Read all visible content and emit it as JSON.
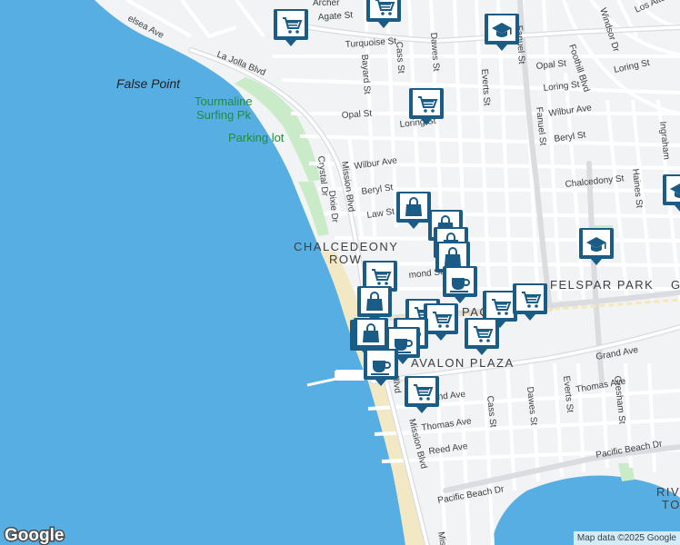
{
  "places": {
    "false_point": "False Point",
    "tourmaline_1": "Tourmaline",
    "tourmaline_2": "Surfing Pk",
    "parking": "Parking lot",
    "chalcedeony_1": "CHALCEDEONY",
    "chalcedeony_2": "ROW",
    "felspar_park": "FELSPAR PARK",
    "avalon_plaza": "AVALON PLAZA",
    "pac": "PAC",
    "riv": "RIV",
    "to": "TO",
    "g_edge": "G"
  },
  "streets": {
    "chelsea": "elsea Ave",
    "agate": "Agate St",
    "archer": "Archer",
    "turquoise": "Turquoise St",
    "la_jolla": "La Jolla Blvd",
    "bayard": "Bayard St",
    "cass_n": "Cass St",
    "dawes_n": "Dawes St",
    "fanuel_n": "Fanuel St",
    "foothill": "Foothill Blvd",
    "windsor": "Windsor Dr",
    "los_altos": "Los Altos",
    "opal_e": "Opal St",
    "opal_w": "Opal St",
    "loring_e": "Loring St",
    "loring_w": "Loring St",
    "loring_ne": "Loring St",
    "wilbur_e": "Wilbur Ave",
    "wilbur_w": "Wilbur Ave",
    "everts_n": "Everts St",
    "fanuel_mid": "Fanuel St",
    "beryl_e": "Beryl St",
    "beryl_w": "Beryl St",
    "ingraham": "Ingraham",
    "chalcedony": "Chalcedony St",
    "haines": "Haines St",
    "crystal": "Crystal Dr",
    "dixie": "Dixie Dr",
    "mission_n": "Mission Blvd",
    "law": "Law St",
    "diamond": "mond St",
    "grand": "Grand Ave",
    "grand_w": "nd Ave",
    "thomas_e": "Thomas Ave",
    "thomas_w": "Thomas Ave",
    "gresham": "Gresham St",
    "everts_s": "Everts St",
    "dawes_s": "Dawes St",
    "cass_s": "Cass St",
    "mission_s": "Mission Blvd",
    "blvd": "Blvd",
    "reed": "Reed Ave",
    "pb_drive_e": "Pacific Beach Dr",
    "pb_drive_w": "Pacific Beach Dr",
    "mis": "Mis"
  },
  "branding": {
    "google": "Google"
  },
  "attribution": "Map data ©2025 Google",
  "colors": {
    "water": "#56aee2",
    "land": "#f1f3f4",
    "park": "#c9ebc7",
    "beach": "#f3e8c4",
    "road": "#ffffff",
    "arterial": "#dadce0",
    "pin": "#1a5c86"
  },
  "markers": [
    {
      "icon": "shopping-cart-icon"
    },
    {
      "icon": "shopping-cart-icon"
    },
    {
      "icon": "school-icon"
    },
    {
      "icon": "shopping-cart-icon"
    },
    {
      "icon": "shopping-bag-icon"
    },
    {
      "icon": "shopping-bag-icon"
    },
    {
      "icon": "shopping-bag-icon"
    },
    {
      "icon": "shopping-bag-icon"
    },
    {
      "icon": "school-icon"
    },
    {
      "icon": "shopping-cart-icon"
    },
    {
      "icon": "shopping-bag-icon"
    },
    {
      "icon": "coffee-cup-icon"
    },
    {
      "icon": "shopping-cart-icon"
    },
    {
      "icon": "shopping-cart-icon"
    },
    {
      "icon": "shopping-bag-icon"
    },
    {
      "icon": "shopping-cart-icon"
    },
    {
      "icon": "shopping-cart-icon"
    },
    {
      "icon": "coffee-cup-icon"
    },
    {
      "icon": "shopping-bag-icon"
    },
    {
      "icon": "coffee-cup-icon"
    },
    {
      "icon": "shopping-cart-icon"
    },
    {
      "icon": "coffee-cup-icon"
    },
    {
      "icon": "shopping-cart-icon"
    },
    {
      "icon": "school-icon"
    }
  ]
}
